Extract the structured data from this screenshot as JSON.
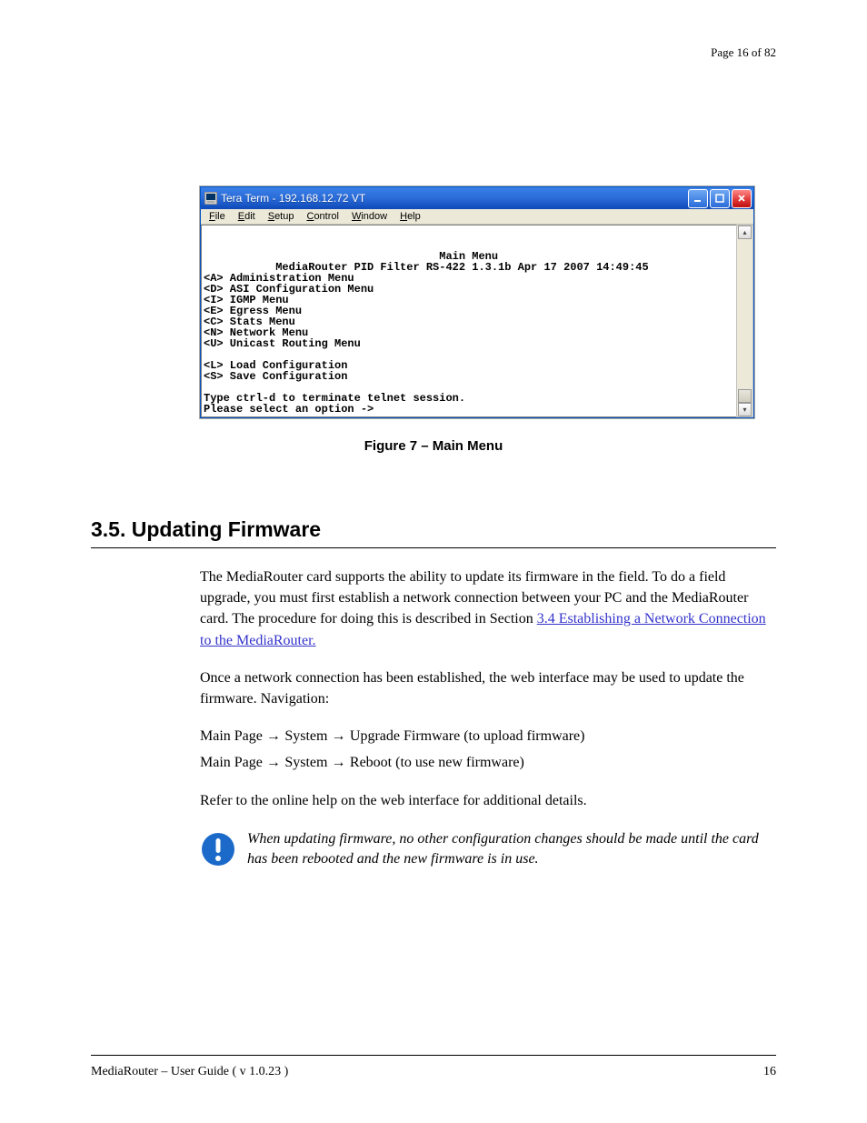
{
  "header": {
    "page": "Page 16 of 82"
  },
  "teraterm": {
    "title": "Tera Term - 192.168.12.72 VT",
    "menus": [
      {
        "underline": "F",
        "rest": "ile"
      },
      {
        "underline": "E",
        "rest": "dit"
      },
      {
        "underline": "S",
        "rest": "etup"
      },
      {
        "underline": "C",
        "rest": "ontrol"
      },
      {
        "underline": "W",
        "rest": "indow"
      },
      {
        "underline": "H",
        "rest": "elp"
      }
    ],
    "terminal": {
      "title": "Main Menu",
      "subtitle": "MediaRouter PID Filter RS-422 1.3.1b Apr 17 2007 14:49:45",
      "items": [
        "<A> Administration Menu",
        "<D> ASI Configuration Menu",
        "<I> IGMP Menu",
        "<E> Egress Menu",
        "<C> Stats Menu",
        "<N> Network Menu",
        "<U> Unicast Routing Menu",
        "",
        "<L> Load Configuration",
        "<S> Save Configuration",
        "",
        "Type ctrl-d to terminate telnet session."
      ],
      "prompt": "Please select an option ->"
    }
  },
  "figure": {
    "caption": "Figure 7 – Main Menu"
  },
  "section": {
    "number": "3.5.",
    "title": "Updating Firmware"
  },
  "body": {
    "para1_a": "The MediaRouter card supports the ability to update its firmware in the field. To do a field upgrade, you must first establish a network connection between your PC and the MediaRouter card. The procedure for doing this is described in Section ",
    "para1_link": "3.4 Establishing a Network Connection to the MediaRouter.",
    "para2": "Once a network connection has been established, the web interface may be used to update the firmware. Navigation:",
    "nav1": {
      "a": "Main Page",
      "b": "System",
      "c": "Upgrade Firmware (to upload firmware)"
    },
    "nav2": {
      "a": "Main Page",
      "b": "System",
      "c": "Reboot (to use new firmware)"
    },
    "para3": "Refer to the online help on the web interface for additional details."
  },
  "notice": {
    "text": "When updating firmware, no other configuration changes should be made until the card has been rebooted and the new firmware is in use."
  },
  "footer": {
    "left": "MediaRouter – User Guide ( v 1.0.23 )",
    "right": "16"
  }
}
